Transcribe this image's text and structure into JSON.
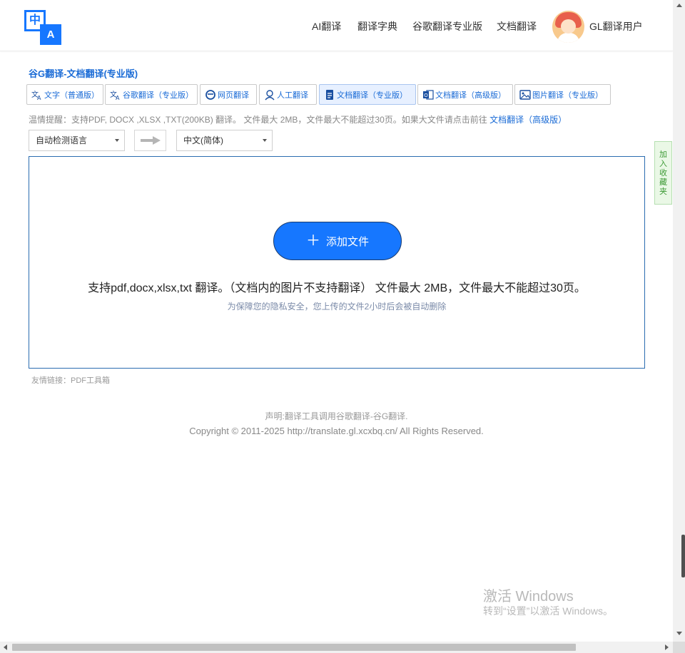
{
  "header": {
    "logo": {
      "top_glyph": "中",
      "bottom_glyph": "A"
    },
    "nav": [
      "AI翻译",
      "翻译字典",
      "谷歌翻译专业版",
      "文档翻译"
    ],
    "username": "GL翻译用户"
  },
  "page_title": "谷G翻译-文档翻译(专业版)",
  "tabs": [
    {
      "label": "文字（普通版）",
      "icon": "translate-icon"
    },
    {
      "label": "谷歌翻译（专业版）",
      "icon": "translate-icon"
    },
    {
      "label": "网页翻译",
      "icon": "web-page-icon"
    },
    {
      "label": "人工翻译",
      "icon": "human-translator-icon"
    },
    {
      "label": "文档翻译（专业版）",
      "icon": "document-icon",
      "active": true
    },
    {
      "label": "文档翻译（高级版）",
      "icon": "office-document-icon"
    },
    {
      "label": "图片翻译（专业版）",
      "icon": "image-icon"
    }
  ],
  "notice": {
    "text": "温情提醒：支持PDF, DOCX ,XLSX ,TXT(200KB) 翻译。 文件最大 2MB，文件最大不能超过30页。如果大文件请点击前往 ",
    "link": "文档翻译（高级版）"
  },
  "language": {
    "source": "自动检测语言",
    "target": "中文(简体)"
  },
  "upload": {
    "button_label": "添加文件",
    "support_text": "支持pdf,docx,xlsx,txt 翻译。（文档内的图片不支持翻译） 文件最大 2MB，文件最大不能超过30页。",
    "privacy_text": "为保障您的隐私安全，您上传的文件2小时后会被自动删除"
  },
  "friend_links": "友情链接：PDF工具箱",
  "footer": {
    "disclaimer": "声明:翻译工具调用谷歌翻译-谷G翻译.",
    "copyright": "Copyright © 2011-2025 http://translate.gl.xcxbq.cn/ All Rights Reserved."
  },
  "bookmark": "加入收藏夹",
  "watermark": {
    "line1": "激活 Windows",
    "line2": "转到“设置”以激活 Windows。"
  },
  "colors": {
    "accent": "#1677ff",
    "link": "#1a6bd6",
    "bookmark_green": "#3d9a35"
  }
}
